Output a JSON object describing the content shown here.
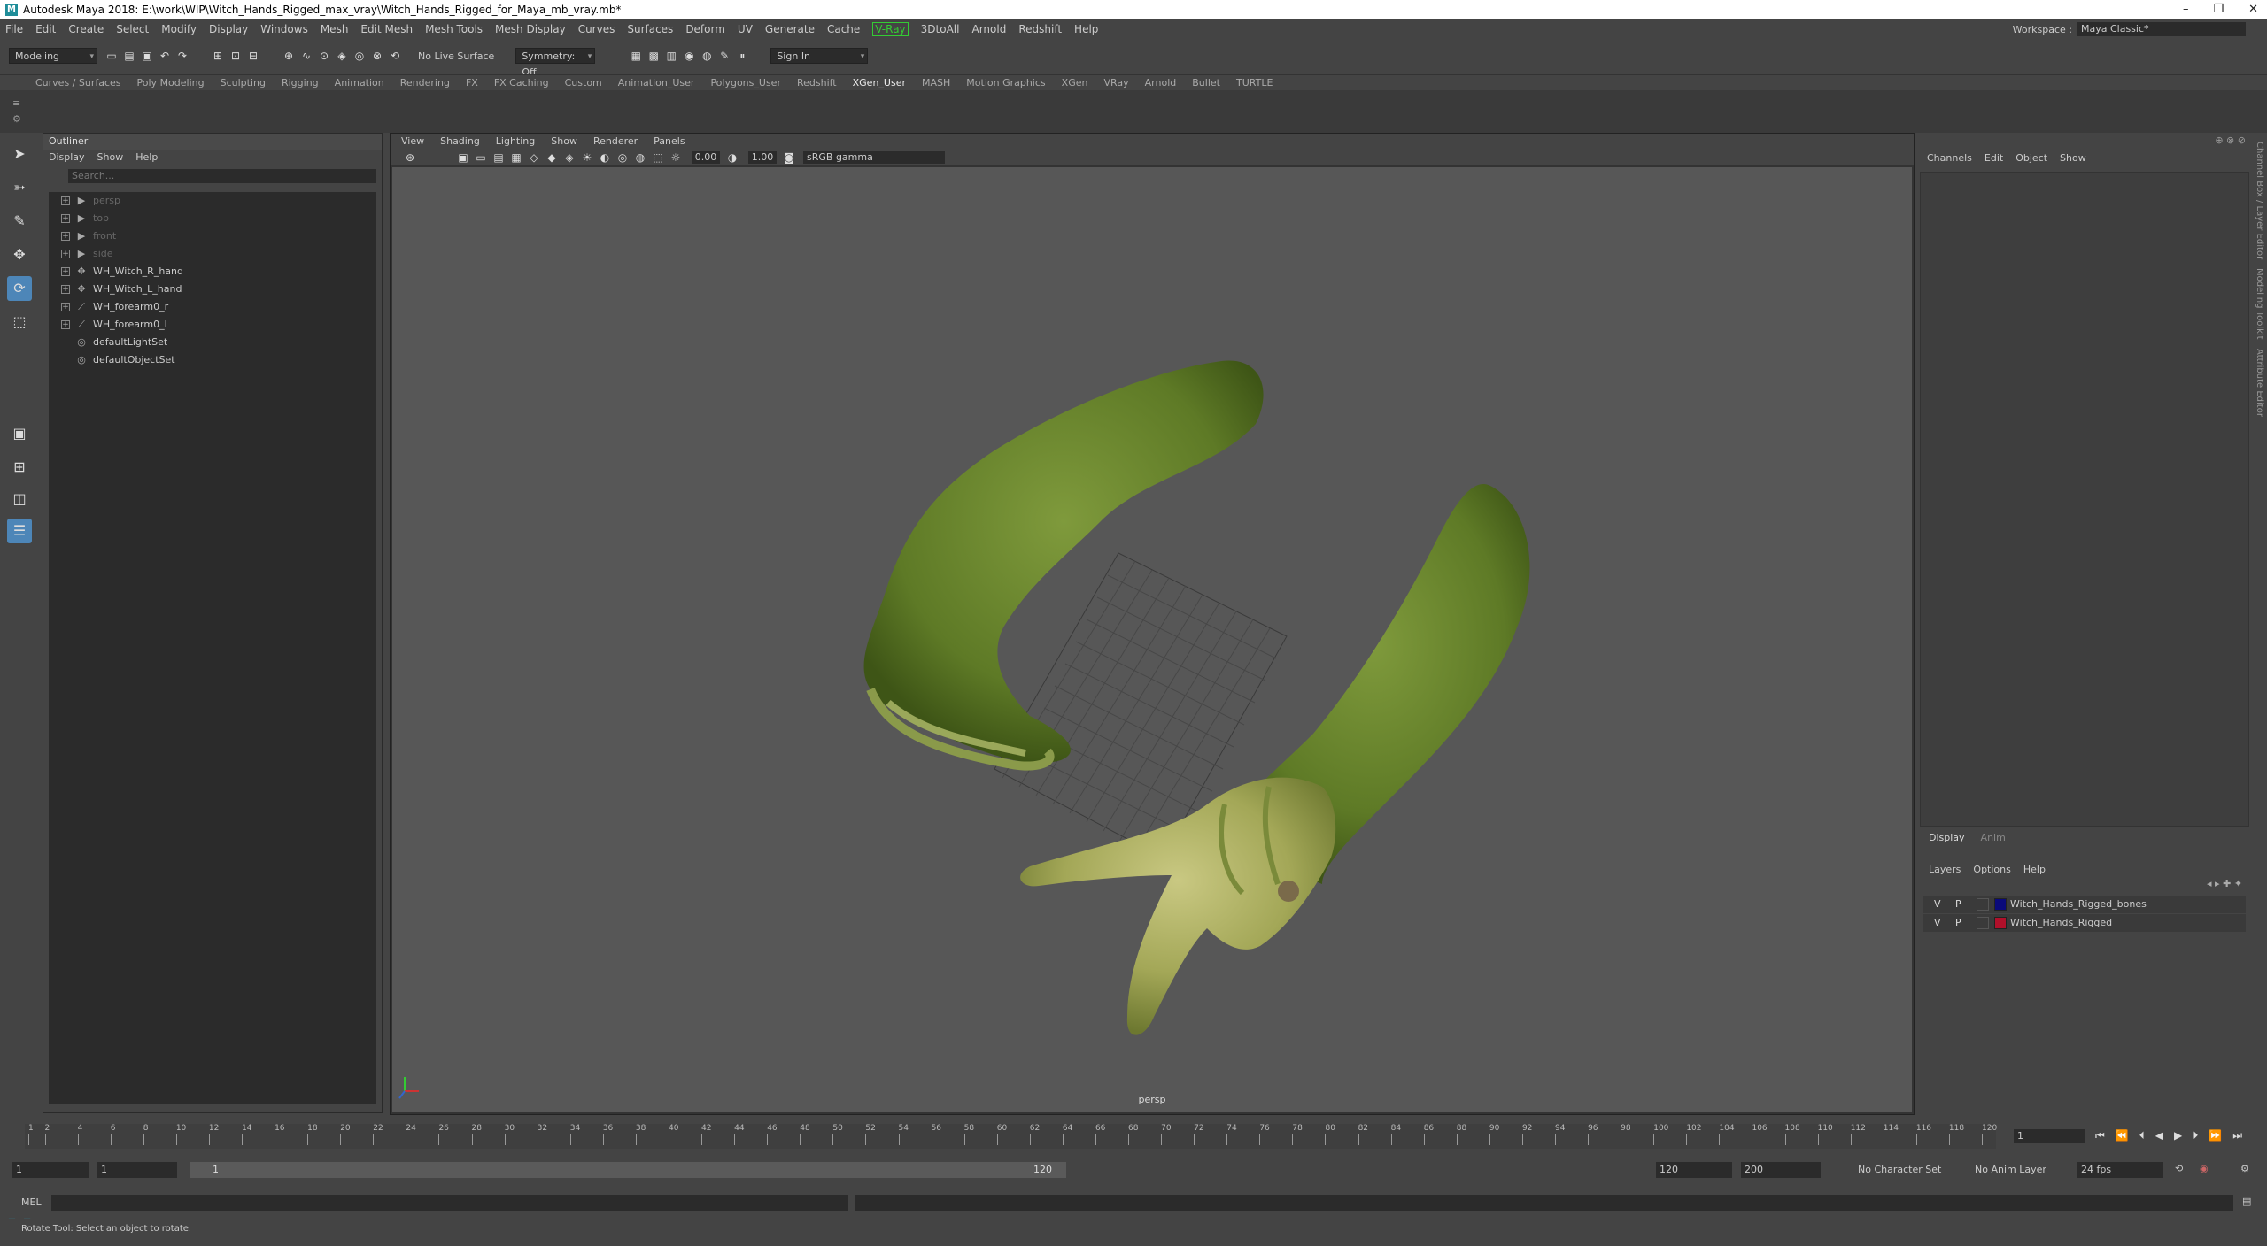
{
  "window": {
    "title": "Autodesk Maya 2018: E:\\work\\WIP\\Witch_Hands_Rigged_max_vray\\Witch_Hands_Rigged_for_Maya_mb_vray.mb*",
    "logo": "M"
  },
  "menu": [
    "File",
    "Edit",
    "Create",
    "Select",
    "Modify",
    "Display",
    "Windows",
    "Mesh",
    "Edit Mesh",
    "Mesh Tools",
    "Mesh Display",
    "Curves",
    "Surfaces",
    "Deform",
    "UV",
    "Generate",
    "Cache",
    "V-Ray",
    "3DtoAll",
    "Arnold",
    "Redshift",
    "Help"
  ],
  "workspace": {
    "label": "Workspace :",
    "value": "Maya Classic*"
  },
  "statusline": {
    "mode": "Modeling",
    "live_surface": "No Live Surface",
    "symmetry": "Symmetry: Off",
    "sign_in": "Sign In"
  },
  "shelf_tabs": [
    "Curves / Surfaces",
    "Poly Modeling",
    "Sculpting",
    "Rigging",
    "Animation",
    "Rendering",
    "FX",
    "FX Caching",
    "Custom",
    "Animation_User",
    "Polygons_User",
    "Redshift",
    "XGen_User",
    "MASH",
    "Motion Graphics",
    "XGen",
    "VRay",
    "Arnold",
    "Bullet",
    "TURTLE"
  ],
  "active_shelf": "XGen_User",
  "outliner": {
    "title": "Outliner",
    "menu": [
      "Display",
      "Show",
      "Help"
    ],
    "search_placeholder": "Search...",
    "items": [
      {
        "label": "persp",
        "icon": "camera-icon",
        "dim": true
      },
      {
        "label": "top",
        "icon": "camera-icon",
        "dim": true
      },
      {
        "label": "front",
        "icon": "camera-icon",
        "dim": true
      },
      {
        "label": "side",
        "icon": "camera-icon",
        "dim": true
      },
      {
        "label": "WH_Witch_R_hand",
        "icon": "transform-icon",
        "dim": false
      },
      {
        "label": "WH_Witch_L_hand",
        "icon": "transform-icon",
        "dim": false
      },
      {
        "label": "WH_forearm0_r",
        "icon": "joint-icon",
        "dim": false
      },
      {
        "label": "WH_forearm0_l",
        "icon": "joint-icon",
        "dim": false
      },
      {
        "label": "defaultLightSet",
        "icon": "set-icon",
        "dim": false
      },
      {
        "label": "defaultObjectSet",
        "icon": "set-icon",
        "dim": false
      }
    ]
  },
  "viewport": {
    "menu": [
      "View",
      "Shading",
      "Lighting",
      "Show",
      "Renderer",
      "Panels"
    ],
    "exposure": "0.00",
    "gamma": "1.00",
    "color_space": "sRGB gamma",
    "camera_label": "persp"
  },
  "channel_box": {
    "menu": [
      "Channels",
      "Edit",
      "Object",
      "Show"
    ]
  },
  "layer_editor": {
    "tabs": [
      "Display",
      "Anim"
    ],
    "menu": [
      "Layers",
      "Options",
      "Help"
    ],
    "layers": [
      {
        "v": "V",
        "p": "P",
        "name": "Witch_Hands_Rigged_bones",
        "color": "#0a0a7a"
      },
      {
        "v": "V",
        "p": "P",
        "name": "Witch_Hands_Rigged",
        "color": "#b0102a"
      }
    ]
  },
  "side_tabs": [
    "Channel Box / Layer Editor",
    "Modeling Toolkit",
    "Attribute Editor"
  ],
  "timeline": {
    "ticks": [
      "1",
      "2",
      "4",
      "6",
      "8",
      "10",
      "12",
      "14",
      "16",
      "18",
      "20",
      "22",
      "24",
      "26",
      "28",
      "30",
      "32",
      "34",
      "36",
      "38",
      "40",
      "42",
      "44",
      "46",
      "48",
      "50",
      "52",
      "54",
      "56",
      "58",
      "60",
      "62",
      "64",
      "66",
      "68",
      "70",
      "72",
      "74",
      "76",
      "78",
      "80",
      "82",
      "84",
      "86",
      "88",
      "90",
      "92",
      "94",
      "96",
      "98",
      "100",
      "102",
      "104",
      "106",
      "108",
      "110",
      "112",
      "114",
      "116",
      "118",
      "120"
    ],
    "current_frame": "1"
  },
  "range": {
    "start": "1",
    "inner_start": "1",
    "slider_start": "1",
    "slider_end": "120",
    "end": "120",
    "max_end": "200",
    "character_set": "No Character Set",
    "anim_layer": "No Anim Layer",
    "fps": "24 fps"
  },
  "mel": {
    "label": "MEL"
  },
  "help_line": "Rotate Tool: Select an object to rotate."
}
